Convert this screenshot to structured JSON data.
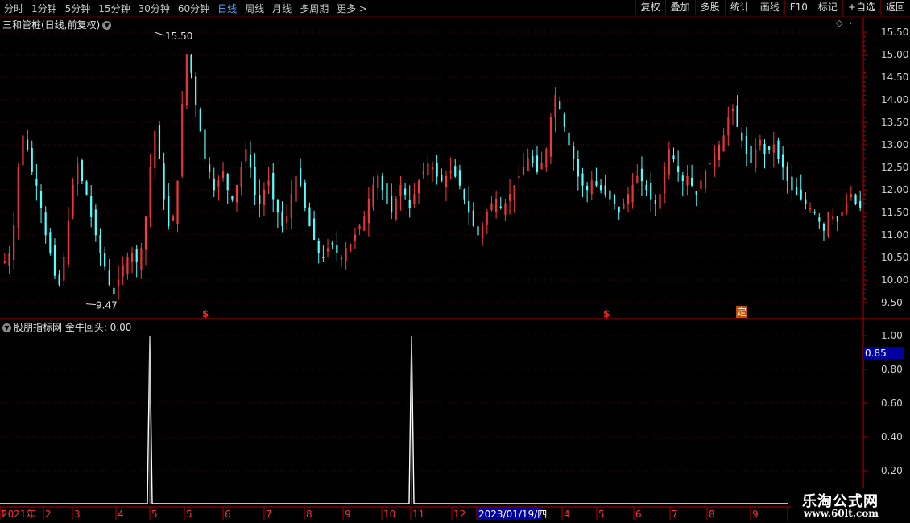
{
  "toolbar": {
    "periods": [
      "分时",
      "1分钟",
      "5分钟",
      "15分钟",
      "30分钟",
      "60分钟",
      "日线",
      "周线",
      "月线",
      "多周期",
      "更多 >"
    ],
    "active_period": "日线",
    "right_buttons": [
      "复权",
      "叠加",
      "多股",
      "统计",
      "画线",
      "F10",
      "标记",
      "+自选",
      "返回"
    ]
  },
  "main_chart": {
    "title": "三和管桩(日线,前复权)",
    "high_label": "15.50",
    "low_label": "9.47",
    "y_ticks": [
      "15.50",
      "15.00",
      "14.50",
      "14.00",
      "13.50",
      "13.00",
      "12.50",
      "12.00",
      "11.50",
      "11.00",
      "10.50",
      "10.00",
      "9.50"
    ],
    "markers": [
      "$",
      "$",
      "定"
    ]
  },
  "indicator": {
    "title": "股朋指标网 金牛回头: 0.00",
    "y_ticks": [
      "1.00",
      "0.80",
      "0.60",
      "0.40",
      "0.20"
    ],
    "current_value": "0.85"
  },
  "x_axis": {
    "labels": [
      "2021年",
      "2",
      "3",
      "4",
      "5",
      "5",
      "6",
      "7",
      "8",
      "9",
      "10",
      "11",
      "12",
      "1",
      "2023/01/19/四",
      "4",
      "5",
      "6",
      "7",
      "8",
      "9"
    ]
  },
  "watermark": {
    "line1": "乐淘公式网",
    "line2": "www.60lt.com"
  },
  "colors": {
    "up": "#ff3c3c",
    "down": "#54ffff",
    "axis": "#b40000",
    "grid": "#500000",
    "signal": "#ffffff",
    "highlight": "#0000a0"
  },
  "chart_data": {
    "type": "candlestick",
    "price_range": [
      9.3,
      15.75
    ],
    "high": 15.5,
    "low": 9.47,
    "indicator_range": [
      0,
      1.05
    ],
    "indicator_spikes": [
      1.0,
      1.0
    ],
    "closes": [
      10.4,
      10.6,
      11.2,
      12.5,
      13.2,
      12.9,
      12.4,
      12.1,
      11.6,
      11.0,
      10.6,
      10.1,
      9.9,
      10.5,
      11.3,
      12.1,
      12.6,
      12.2,
      11.9,
      11.4,
      11.0,
      10.6,
      10.3,
      9.9,
      9.7,
      10.0,
      10.3,
      10.5,
      10.6,
      10.4,
      10.7,
      11.4,
      12.5,
      13.3,
      12.7,
      11.8,
      11.2,
      11.4,
      12.2,
      13.9,
      15.0,
      14.6,
      13.9,
      13.3,
      12.7,
      12.4,
      12.0,
      12.2,
      12.4,
      12.0,
      11.8,
      12.1,
      12.5,
      12.9,
      12.5,
      11.9,
      11.7,
      12.0,
      12.2,
      11.8,
      11.5,
      11.2,
      11.4,
      11.9,
      12.3,
      12.1,
      11.6,
      11.2,
      10.9,
      10.6,
      10.5,
      10.7,
      10.8,
      10.6,
      10.5,
      10.7,
      10.8,
      11.0,
      11.2,
      11.4,
      11.8,
      12.1,
      12.3,
      12.0,
      11.7,
      11.5,
      11.8,
      12.1,
      11.9,
      11.6,
      11.9,
      12.2,
      12.4,
      12.6,
      12.5,
      12.3,
      12.2,
      12.3,
      12.4,
      12.3,
      12.1,
      11.8,
      11.5,
      11.2,
      11.0,
      11.2,
      11.5,
      11.7,
      11.8,
      11.6,
      11.7,
      11.9,
      12.1,
      12.3,
      12.5,
      12.7,
      12.6,
      12.4,
      12.6,
      12.9,
      13.6,
      14.1,
      13.8,
      13.4,
      13.0,
      12.7,
      12.3,
      12.1,
      12.0,
      12.2,
      12.1,
      12.0,
      11.9,
      11.8,
      11.7,
      11.5,
      11.7,
      11.9,
      12.1,
      12.3,
      12.2,
      12.0,
      11.8,
      11.7,
      11.9,
      12.5,
      12.9,
      12.7,
      12.4,
      12.2,
      12.3,
      12.1,
      11.9,
      12.2,
      12.4,
      12.6,
      12.8,
      13.0,
      13.2,
      13.6,
      13.8,
      13.4,
      13.1,
      12.8,
      12.6,
      12.9,
      13.1,
      12.8,
      12.9,
      13.0,
      12.7,
      12.5,
      12.2,
      12.0,
      11.9,
      11.8,
      11.7,
      11.6,
      11.5,
      11.3,
      11.1,
      11.5,
      11.4,
      11.3,
      11.5,
      11.7,
      11.9,
      11.7,
      11.6
    ]
  }
}
